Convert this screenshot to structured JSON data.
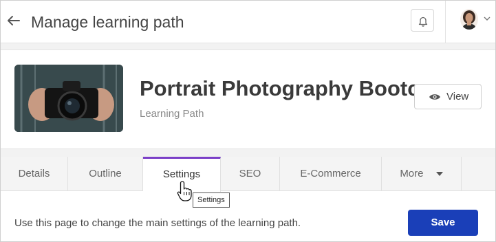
{
  "header": {
    "title": "Manage learning path",
    "back_icon": "arrow-left-icon",
    "notification_icon": "bell-icon"
  },
  "course": {
    "title": "Portrait Photography Bootc...",
    "type": "Learning Path",
    "view_label": "View"
  },
  "tabs": [
    {
      "label": "Details",
      "active": false
    },
    {
      "label": "Outline",
      "active": false
    },
    {
      "label": "Settings",
      "active": true
    },
    {
      "label": "SEO",
      "active": false
    },
    {
      "label": "E-Commerce",
      "active": false
    },
    {
      "label": "More",
      "active": false
    }
  ],
  "tooltip": {
    "text": "Settings"
  },
  "content": {
    "description": "Use this page to change the main settings of the learning path.",
    "save_label": "Save"
  },
  "colors": {
    "accent": "#7b3fc8",
    "primary_button": "#1a3fb8"
  }
}
